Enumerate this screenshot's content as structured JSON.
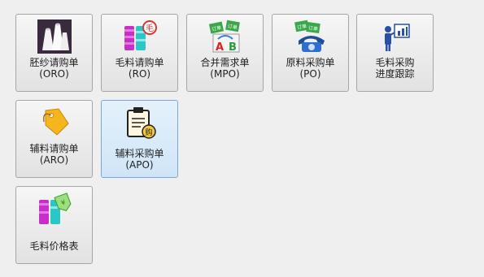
{
  "tiles": [
    {
      "l1": "胚纱请购单",
      "l2": "(ORO)",
      "icon": "yarn-cones-icon"
    },
    {
      "l1": "毛料请购单",
      "l2": "(RO)",
      "icon": "wool-spools-icon"
    },
    {
      "l1": "合并需求单",
      "l2": "(MPO)",
      "icon": "merge-orders-icon"
    },
    {
      "l1": "原料采购单",
      "l2": "(PO)",
      "icon": "phone-order-icon"
    },
    {
      "l1": "毛料采购",
      "l2": "进度跟踪",
      "icon": "presentation-icon"
    },
    {
      "l1": "辅料请购单",
      "l2": "(ARO)",
      "icon": "tag-icon"
    },
    {
      "l1": "辅料采购单",
      "l2": "(APO)",
      "icon": "clipboard-purchase-icon"
    },
    {
      "l1": "毛料价格表",
      "l2": "",
      "icon": "price-tag-spools-icon"
    }
  ],
  "icon_text": {
    "order_badge": "订单",
    "wool_badge": "毛",
    "buy_badge": "购",
    "letter_a": "A",
    "letter_b": "B"
  }
}
